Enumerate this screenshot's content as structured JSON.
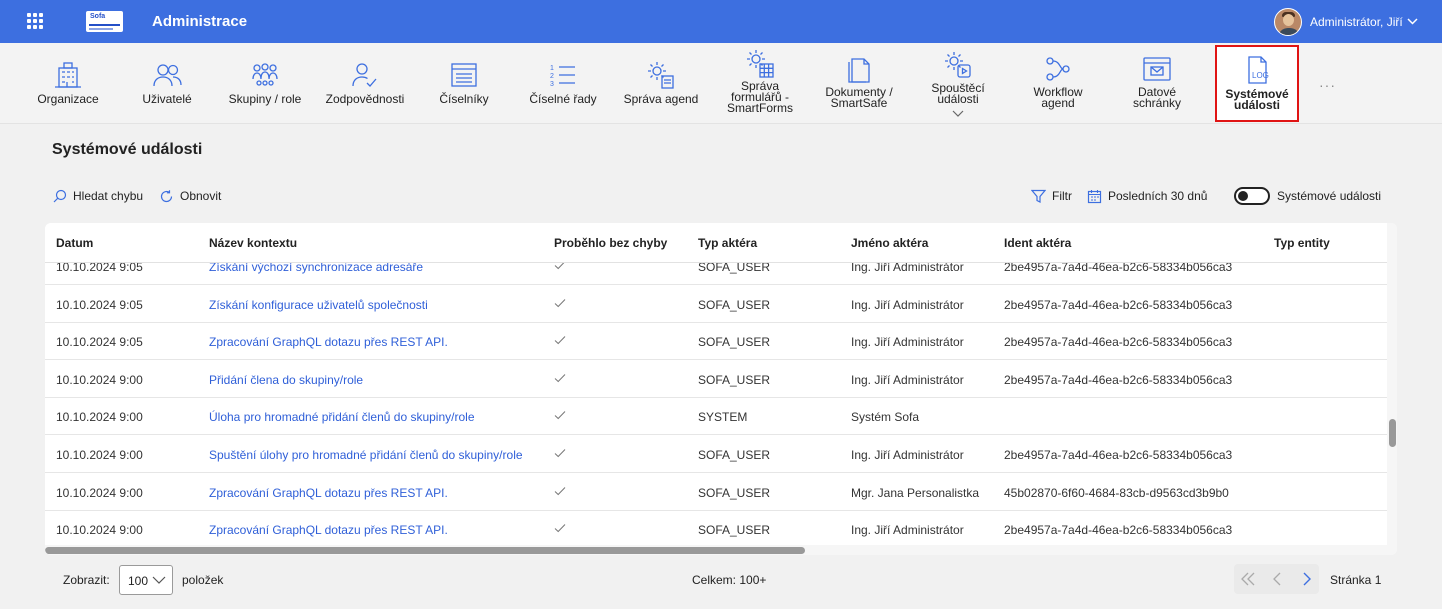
{
  "header": {
    "app_title": "Administrace",
    "user_name": "Administrátor, Jiří",
    "logo_text": "Sofa"
  },
  "toolbar": {
    "items": [
      {
        "label": "Organizace",
        "icon": "building-icon"
      },
      {
        "label": "Uživatelé",
        "icon": "users-icon"
      },
      {
        "label": "Skupiny / role",
        "icon": "groups-icon"
      },
      {
        "label": "Zodpovědnosti",
        "icon": "user-check-icon"
      },
      {
        "label": "Číselníky",
        "icon": "list-box-icon"
      },
      {
        "label": "Číselné řady",
        "icon": "numbered-list-icon"
      },
      {
        "label": "Správa agend",
        "icon": "gear-doc-icon"
      },
      {
        "label": "Správa\nformulářů -\nSmartForms",
        "icon": "gear-grid-icon"
      },
      {
        "label": "Dokumenty /\nSmartSafe",
        "icon": "documents-icon"
      },
      {
        "label": "Spouštěcí\nudálosti",
        "icon": "gear-play-icon"
      },
      {
        "label": "Workflow\nagend",
        "icon": "workflow-icon"
      },
      {
        "label": "Datové\nschránky",
        "icon": "mailbox-icon"
      },
      {
        "label": "Systémové\nudálosti",
        "icon": "log-file-icon"
      }
    ],
    "more": "···"
  },
  "page": {
    "title": "Systémové události",
    "search_label": "Hledat chybu",
    "refresh_label": "Obnovit",
    "filter_label": "Filtr",
    "period_label": "Posledních 30 dnů",
    "toggle_label": "Systémové události"
  },
  "table": {
    "columns": [
      "Datum",
      "Název kontextu",
      "Proběhlo bez chyby",
      "Typ aktéra",
      "Jméno aktéra",
      "Ident aktéra",
      "Typ entity"
    ],
    "rows": [
      {
        "date": "10.10.2024 9:05",
        "context": "Získání výchozí synchronizace adresáře",
        "ok": true,
        "actor_type": "SOFA_USER",
        "actor_name": "Ing. Jiří Administrátor",
        "actor_id": "2be4957a-7a4d-46ea-b2c6-58334b056ca3",
        "entity": ""
      },
      {
        "date": "10.10.2024 9:05",
        "context": "Získání konfigurace uživatelů společnosti",
        "ok": true,
        "actor_type": "SOFA_USER",
        "actor_name": "Ing. Jiří Administrátor",
        "actor_id": "2be4957a-7a4d-46ea-b2c6-58334b056ca3",
        "entity": ""
      },
      {
        "date": "10.10.2024 9:05",
        "context": "Zpracování GraphQL dotazu přes REST API.",
        "ok": true,
        "actor_type": "SOFA_USER",
        "actor_name": "Ing. Jiří Administrátor",
        "actor_id": "2be4957a-7a4d-46ea-b2c6-58334b056ca3",
        "entity": ""
      },
      {
        "date": "10.10.2024 9:00",
        "context": "Přidání člena do skupiny/role",
        "ok": true,
        "actor_type": "SOFA_USER",
        "actor_name": "Ing. Jiří Administrátor",
        "actor_id": "2be4957a-7a4d-46ea-b2c6-58334b056ca3",
        "entity": ""
      },
      {
        "date": "10.10.2024 9:00",
        "context": "Úloha pro hromadné přidání členů do skupiny/role",
        "ok": true,
        "actor_type": "SYSTEM",
        "actor_name": "Systém Sofa",
        "actor_id": "",
        "entity": ""
      },
      {
        "date": "10.10.2024 9:00",
        "context": "Spuštění úlohy pro hromadné přidání členů do skupiny/role",
        "ok": true,
        "actor_type": "SOFA_USER",
        "actor_name": "Ing. Jiří Administrátor",
        "actor_id": "2be4957a-7a4d-46ea-b2c6-58334b056ca3",
        "entity": ""
      },
      {
        "date": "10.10.2024 9:00",
        "context": "Zpracování GraphQL dotazu přes REST API.",
        "ok": true,
        "actor_type": "SOFA_USER",
        "actor_name": "Mgr. Jana Personalistka",
        "actor_id": "45b02870-6f60-4684-83cb-d9563cd3b9b0",
        "entity": ""
      },
      {
        "date": "10.10.2024 9:00",
        "context": "Zpracování GraphQL dotazu přes REST API.",
        "ok": true,
        "actor_type": "SOFA_USER",
        "actor_name": "Ing. Jiří Administrátor",
        "actor_id": "2be4957a-7a4d-46ea-b2c6-58334b056ca3",
        "entity": ""
      }
    ]
  },
  "footer": {
    "show_label": "Zobrazit:",
    "page_size": "100",
    "items_label": "položek",
    "total": "Celkem: 100+",
    "page_label": "Stránka 1"
  },
  "colors": {
    "brand": "#3d6fe0",
    "link": "#2f5fd8",
    "highlight": "#e01414"
  }
}
